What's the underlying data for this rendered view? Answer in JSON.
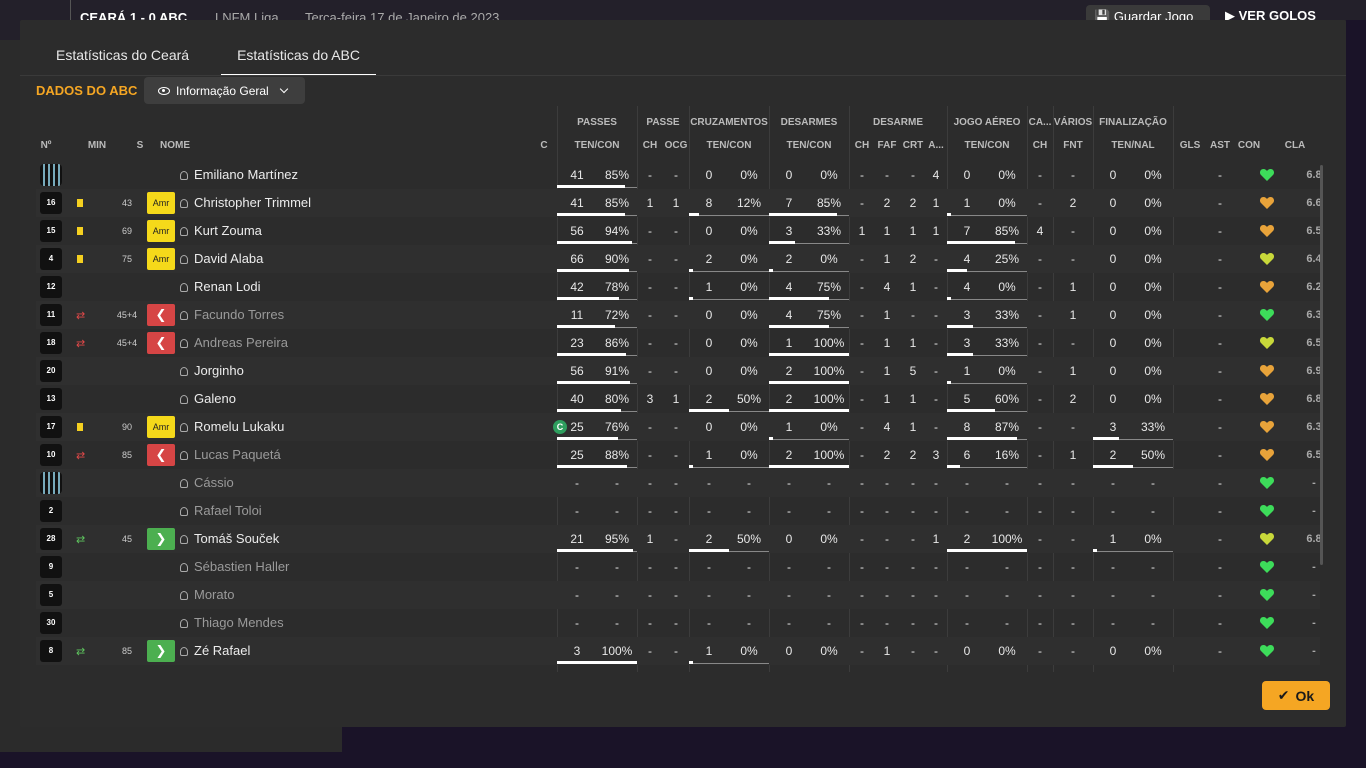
{
  "header": {
    "match": "CEARÁ  1 - 0  ABC",
    "competition": "LNFM Liga",
    "date": "Terça-feira 17 de Janeiro de 2023",
    "save_label": "Guardar Jogo",
    "goals_label": "VER GOLOS"
  },
  "tabs": [
    {
      "label": "Estatísticas do Ceará"
    },
    {
      "label": "Estatísticas do ABC"
    }
  ],
  "section": {
    "title": "DADOS DO ABC",
    "view_label": "Informação Geral"
  },
  "groups": {
    "passes": "PASSES",
    "passe": "PASSE",
    "cruz": "CRUZAMENTOS",
    "desarmes": "DESARMES",
    "desarme": "DESARME",
    "aereo": "JOGO AÉREO",
    "ca": "CA...",
    "varios": "VÁRIOS",
    "final": "FINALIZAÇÃO"
  },
  "columns": {
    "no": "Nº",
    "min": "MIN",
    "s": "S",
    "nome": "NOME",
    "c": "C",
    "pass_tc": "TEN/CON",
    "pass_ch": "CH",
    "pass_ocg": "OCG",
    "cruz_tc": "TEN/CON",
    "des_tc": "TEN/CON",
    "des_ch": "CH",
    "des_faf": "FAF",
    "des_crt": "CRT",
    "des_a": "A...",
    "aer_tc": "TEN/CON",
    "ca_ch": "CH",
    "var_fnt": "FNT",
    "fin_tn": "TEN/NAL",
    "gls": "GLS",
    "ast": "AST",
    "con": "CON",
    "cla": "CLA"
  },
  "players": [
    {
      "no": "",
      "gk": true,
      "min": "",
      "card": false,
      "sub": "",
      "s": "",
      "name": "Emiliano Martínez",
      "captain": false,
      "sub_row": false,
      "p": [
        "41",
        "85%"
      ],
      "pch": "-",
      "pocg": "-",
      "cr": [
        "0",
        "0%"
      ],
      "de": [
        "0",
        "0%"
      ],
      "dch": "-",
      "dfaf": "-",
      "dcrt": "-",
      "da": "4",
      "ae": [
        "0",
        "0%"
      ],
      "cach": "-",
      "fnt": "-",
      "fi": [
        "0",
        "0%"
      ],
      "gls": "",
      "ast": "-",
      "con": "green",
      "cla": "6.8"
    },
    {
      "no": "16",
      "gk": false,
      "min": "43",
      "card": true,
      "sub": "",
      "s": "Amr",
      "name": "Christopher Trimmel",
      "captain": false,
      "sub_row": false,
      "p": [
        "41",
        "85%"
      ],
      "pch": "1",
      "pocg": "1",
      "cr": [
        "8",
        "12%"
      ],
      "de": [
        "7",
        "85%"
      ],
      "dch": "-",
      "dfaf": "2",
      "dcrt": "2",
      "da": "1",
      "ae": [
        "1",
        "0%"
      ],
      "cach": "-",
      "fnt": "2",
      "fi": [
        "0",
        "0%"
      ],
      "gls": "",
      "ast": "-",
      "con": "orange",
      "cla": "6.6"
    },
    {
      "no": "15",
      "gk": false,
      "min": "69",
      "card": true,
      "sub": "",
      "s": "Amr",
      "name": "Kurt Zouma",
      "captain": false,
      "sub_row": false,
      "p": [
        "56",
        "94%"
      ],
      "pch": "-",
      "pocg": "-",
      "cr": [
        "0",
        "0%"
      ],
      "de": [
        "3",
        "33%"
      ],
      "dch": "1",
      "dfaf": "1",
      "dcrt": "1",
      "da": "1",
      "ae": [
        "7",
        "85%"
      ],
      "cach": "4",
      "fnt": "-",
      "fi": [
        "0",
        "0%"
      ],
      "gls": "",
      "ast": "-",
      "con": "orange",
      "cla": "6.5"
    },
    {
      "no": "4",
      "gk": false,
      "min": "75",
      "card": true,
      "sub": "",
      "s": "Amr",
      "name": "David Alaba",
      "captain": false,
      "sub_row": false,
      "p": [
        "66",
        "90%"
      ],
      "pch": "-",
      "pocg": "-",
      "cr": [
        "2",
        "0%"
      ],
      "de": [
        "2",
        "0%"
      ],
      "dch": "-",
      "dfaf": "1",
      "dcrt": "2",
      "da": "-",
      "ae": [
        "4",
        "25%"
      ],
      "cach": "-",
      "fnt": "-",
      "fi": [
        "0",
        "0%"
      ],
      "gls": "",
      "ast": "-",
      "con": "yellow",
      "cla": "6.4"
    },
    {
      "no": "12",
      "gk": false,
      "min": "",
      "card": false,
      "sub": "",
      "s": "",
      "name": "Renan Lodi",
      "captain": false,
      "sub_row": false,
      "p": [
        "42",
        "78%"
      ],
      "pch": "-",
      "pocg": "-",
      "cr": [
        "1",
        "0%"
      ],
      "de": [
        "4",
        "75%"
      ],
      "dch": "-",
      "dfaf": "4",
      "dcrt": "1",
      "da": "-",
      "ae": [
        "4",
        "0%"
      ],
      "cach": "-",
      "fnt": "1",
      "fi": [
        "0",
        "0%"
      ],
      "gls": "",
      "ast": "-",
      "con": "orange",
      "cla": "6.2"
    },
    {
      "no": "11",
      "gk": false,
      "min": "45+4",
      "card": false,
      "sub": "out",
      "s": "<",
      "name": "Facundo Torres",
      "captain": false,
      "sub_row": true,
      "p": [
        "11",
        "72%"
      ],
      "pch": "-",
      "pocg": "-",
      "cr": [
        "0",
        "0%"
      ],
      "de": [
        "4",
        "75%"
      ],
      "dch": "-",
      "dfaf": "1",
      "dcrt": "-",
      "da": "-",
      "ae": [
        "3",
        "33%"
      ],
      "cach": "-",
      "fnt": "1",
      "fi": [
        "0",
        "0%"
      ],
      "gls": "",
      "ast": "-",
      "con": "green",
      "cla": "6.3"
    },
    {
      "no": "18",
      "gk": false,
      "min": "45+4",
      "card": false,
      "sub": "out",
      "s": "<",
      "name": "Andreas Pereira",
      "captain": false,
      "sub_row": true,
      "p": [
        "23",
        "86%"
      ],
      "pch": "-",
      "pocg": "-",
      "cr": [
        "0",
        "0%"
      ],
      "de": [
        "1",
        "100%"
      ],
      "dch": "-",
      "dfaf": "1",
      "dcrt": "1",
      "da": "-",
      "ae": [
        "3",
        "33%"
      ],
      "cach": "-",
      "fnt": "-",
      "fi": [
        "0",
        "0%"
      ],
      "gls": "",
      "ast": "-",
      "con": "yellow",
      "cla": "6.5"
    },
    {
      "no": "20",
      "gk": false,
      "min": "",
      "card": false,
      "sub": "",
      "s": "",
      "name": "Jorginho",
      "captain": false,
      "sub_row": false,
      "p": [
        "56",
        "91%"
      ],
      "pch": "-",
      "pocg": "-",
      "cr": [
        "0",
        "0%"
      ],
      "de": [
        "2",
        "100%"
      ],
      "dch": "-",
      "dfaf": "1",
      "dcrt": "5",
      "da": "-",
      "ae": [
        "1",
        "0%"
      ],
      "cach": "-",
      "fnt": "1",
      "fi": [
        "0",
        "0%"
      ],
      "gls": "",
      "ast": "-",
      "con": "orange",
      "cla": "6.9"
    },
    {
      "no": "13",
      "gk": false,
      "min": "",
      "card": false,
      "sub": "",
      "s": "",
      "name": "Galeno",
      "captain": false,
      "sub_row": false,
      "p": [
        "40",
        "80%"
      ],
      "pch": "3",
      "pocg": "1",
      "cr": [
        "2",
        "50%"
      ],
      "de": [
        "2",
        "100%"
      ],
      "dch": "-",
      "dfaf": "1",
      "dcrt": "1",
      "da": "-",
      "ae": [
        "5",
        "60%"
      ],
      "cach": "-",
      "fnt": "2",
      "fi": [
        "0",
        "0%"
      ],
      "gls": "",
      "ast": "-",
      "con": "orange",
      "cla": "6.8"
    },
    {
      "no": "17",
      "gk": false,
      "min": "90",
      "card": true,
      "sub": "",
      "s": "Amr",
      "name": "Romelu Lukaku",
      "captain": true,
      "sub_row": false,
      "p": [
        "25",
        "76%"
      ],
      "pch": "-",
      "pocg": "-",
      "cr": [
        "0",
        "0%"
      ],
      "de": [
        "1",
        "0%"
      ],
      "dch": "-",
      "dfaf": "4",
      "dcrt": "1",
      "da": "-",
      "ae": [
        "8",
        "87%"
      ],
      "cach": "-",
      "fnt": "-",
      "fi": [
        "3",
        "33%"
      ],
      "gls": "",
      "ast": "-",
      "con": "orange",
      "cla": "6.3"
    },
    {
      "no": "10",
      "gk": false,
      "min": "85",
      "card": false,
      "sub": "out",
      "s": "<",
      "name": "Lucas Paquetá",
      "captain": false,
      "sub_row": true,
      "p": [
        "25",
        "88%"
      ],
      "pch": "-",
      "pocg": "-",
      "cr": [
        "1",
        "0%"
      ],
      "de": [
        "2",
        "100%"
      ],
      "dch": "-",
      "dfaf": "2",
      "dcrt": "2",
      "da": "3",
      "ae": [
        "6",
        "16%"
      ],
      "cach": "-",
      "fnt": "1",
      "fi": [
        "2",
        "50%"
      ],
      "gls": "",
      "ast": "-",
      "con": "orange",
      "cla": "6.5"
    },
    {
      "no": "",
      "gk": true,
      "min": "",
      "card": false,
      "sub": "",
      "s": "",
      "name": "Cássio",
      "captain": false,
      "sub_row": true,
      "p": [
        "-",
        "-"
      ],
      "pch": "-",
      "pocg": "-",
      "cr": [
        "-",
        "-"
      ],
      "de": [
        "-",
        "-"
      ],
      "dch": "-",
      "dfaf": "-",
      "dcrt": "-",
      "da": "-",
      "ae": [
        "-",
        "-"
      ],
      "cach": "-",
      "fnt": "-",
      "fi": [
        "-",
        "-"
      ],
      "gls": "",
      "ast": "-",
      "con": "green",
      "cla": "-"
    },
    {
      "no": "2",
      "gk": false,
      "min": "",
      "card": false,
      "sub": "",
      "s": "",
      "name": "Rafael Toloi",
      "captain": false,
      "sub_row": true,
      "p": [
        "-",
        "-"
      ],
      "pch": "-",
      "pocg": "-",
      "cr": [
        "-",
        "-"
      ],
      "de": [
        "-",
        "-"
      ],
      "dch": "-",
      "dfaf": "-",
      "dcrt": "-",
      "da": "-",
      "ae": [
        "-",
        "-"
      ],
      "cach": "-",
      "fnt": "-",
      "fi": [
        "-",
        "-"
      ],
      "gls": "",
      "ast": "-",
      "con": "green",
      "cla": "-"
    },
    {
      "no": "28",
      "gk": false,
      "min": "45",
      "card": false,
      "sub": "in",
      "s": ">",
      "name": "Tomáš Souček",
      "captain": false,
      "sub_row": false,
      "p": [
        "21",
        "95%"
      ],
      "pch": "1",
      "pocg": "-",
      "cr": [
        "2",
        "50%"
      ],
      "de": [
        "0",
        "0%"
      ],
      "dch": "-",
      "dfaf": "-",
      "dcrt": "-",
      "da": "1",
      "ae": [
        "2",
        "100%"
      ],
      "cach": "-",
      "fnt": "-",
      "fi": [
        "1",
        "0%"
      ],
      "gls": "",
      "ast": "-",
      "con": "yellow",
      "cla": "6.8"
    },
    {
      "no": "9",
      "gk": false,
      "min": "",
      "card": false,
      "sub": "",
      "s": "",
      "name": "Sébastien Haller",
      "captain": false,
      "sub_row": true,
      "p": [
        "-",
        "-"
      ],
      "pch": "-",
      "pocg": "-",
      "cr": [
        "-",
        "-"
      ],
      "de": [
        "-",
        "-"
      ],
      "dch": "-",
      "dfaf": "-",
      "dcrt": "-",
      "da": "-",
      "ae": [
        "-",
        "-"
      ],
      "cach": "-",
      "fnt": "-",
      "fi": [
        "-",
        "-"
      ],
      "gls": "",
      "ast": "-",
      "con": "green",
      "cla": "-"
    },
    {
      "no": "5",
      "gk": false,
      "min": "",
      "card": false,
      "sub": "",
      "s": "",
      "name": "Morato",
      "captain": false,
      "sub_row": true,
      "p": [
        "-",
        "-"
      ],
      "pch": "-",
      "pocg": "-",
      "cr": [
        "-",
        "-"
      ],
      "de": [
        "-",
        "-"
      ],
      "dch": "-",
      "dfaf": "-",
      "dcrt": "-",
      "da": "-",
      "ae": [
        "-",
        "-"
      ],
      "cach": "-",
      "fnt": "-",
      "fi": [
        "-",
        "-"
      ],
      "gls": "",
      "ast": "-",
      "con": "green",
      "cla": "-"
    },
    {
      "no": "30",
      "gk": false,
      "min": "",
      "card": false,
      "sub": "",
      "s": "",
      "name": "Thiago Mendes",
      "captain": false,
      "sub_row": true,
      "p": [
        "-",
        "-"
      ],
      "pch": "-",
      "pocg": "-",
      "cr": [
        "-",
        "-"
      ],
      "de": [
        "-",
        "-"
      ],
      "dch": "-",
      "dfaf": "-",
      "dcrt": "-",
      "da": "-",
      "ae": [
        "-",
        "-"
      ],
      "cach": "-",
      "fnt": "-",
      "fi": [
        "-",
        "-"
      ],
      "gls": "",
      "ast": "-",
      "con": "green",
      "cla": "-"
    },
    {
      "no": "8",
      "gk": false,
      "min": "85",
      "card": false,
      "sub": "in",
      "s": ">",
      "name": "Zé Rafael",
      "captain": false,
      "sub_row": false,
      "p": [
        "3",
        "100%"
      ],
      "pch": "-",
      "pocg": "-",
      "cr": [
        "1",
        "0%"
      ],
      "de": [
        "0",
        "0%"
      ],
      "dch": "-",
      "dfaf": "1",
      "dcrt": "-",
      "da": "-",
      "ae": [
        "0",
        "0%"
      ],
      "cach": "-",
      "fnt": "-",
      "fi": [
        "0",
        "0%"
      ],
      "gls": "",
      "ast": "-",
      "con": "green",
      "cla": "-"
    }
  ],
  "colors": {
    "accent": "#f5a623",
    "amr": "#f5d91a",
    "out": "#d64545",
    "in": "#4caf50",
    "con_green": "#3ddc5a",
    "con_orange": "#e8a33a",
    "con_yellow": "#c8d83a"
  },
  "ok_label": "Ok"
}
